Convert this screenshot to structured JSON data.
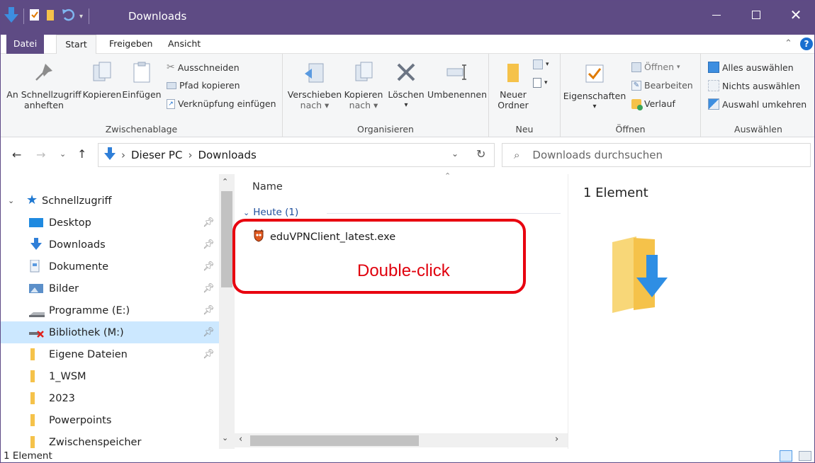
{
  "window": {
    "title": "Downloads"
  },
  "tabs": [
    "Datei",
    "Start",
    "Freigeben",
    "Ansicht"
  ],
  "ribbon": {
    "clipboard": {
      "pin_label_1": "An Schnellzugriff",
      "pin_label_2": "anheften",
      "copy": "Kopieren",
      "paste": "Einfügen",
      "cut": "Ausschneiden",
      "copy_path": "Pfad kopieren",
      "paste_shortcut": "Verknüpfung einfügen",
      "group": "Zwischenablage"
    },
    "organize": {
      "move_1": "Verschieben",
      "move_2": "nach",
      "copyto_1": "Kopieren",
      "copyto_2": "nach",
      "delete": "Löschen",
      "rename": "Umbenennen",
      "group": "Organisieren"
    },
    "new": {
      "folder_1": "Neuer",
      "folder_2": "Ordner",
      "group": "Neu"
    },
    "open": {
      "properties": "Eigenschaften",
      "open": "Öffnen",
      "edit": "Bearbeiten",
      "history": "Verlauf",
      "group": "Öffnen"
    },
    "select": {
      "all": "Alles auswählen",
      "none": "Nichts auswählen",
      "invert": "Auswahl umkehren",
      "group": "Auswählen"
    }
  },
  "address": {
    "this_pc": "Dieser PC",
    "current": "Downloads",
    "search_placeholder": "Downloads durchsuchen"
  },
  "nav": {
    "quick_access": "Schnellzugriff",
    "items": [
      {
        "label": "Desktop",
        "pinned": true
      },
      {
        "label": "Downloads",
        "pinned": true
      },
      {
        "label": "Dokumente",
        "pinned": true
      },
      {
        "label": "Bilder",
        "pinned": true
      },
      {
        "label": "Programme (E:)",
        "pinned": true
      },
      {
        "label": "Bibliothek (M:)",
        "pinned": true
      },
      {
        "label": "Eigene Dateien",
        "pinned": true
      },
      {
        "label": "1_WSM",
        "pinned": false
      },
      {
        "label": "2023",
        "pinned": false
      },
      {
        "label": "Powerpoints",
        "pinned": false
      },
      {
        "label": "Zwischenspeicher",
        "pinned": false
      }
    ]
  },
  "content": {
    "column_name": "Name",
    "group_header": "Heute (1)",
    "files": [
      {
        "name": "eduVPNClient_latest.exe"
      }
    ]
  },
  "annotation": {
    "text": "Double-click",
    "color": "#e8000f"
  },
  "preview": {
    "count": "1 Element"
  },
  "status": {
    "count": "1 Element"
  },
  "colors": {
    "titlebar": "#5e4b84",
    "accent": "#0078d7",
    "folder": "#f5c24a",
    "selection": "#cce8ff"
  }
}
